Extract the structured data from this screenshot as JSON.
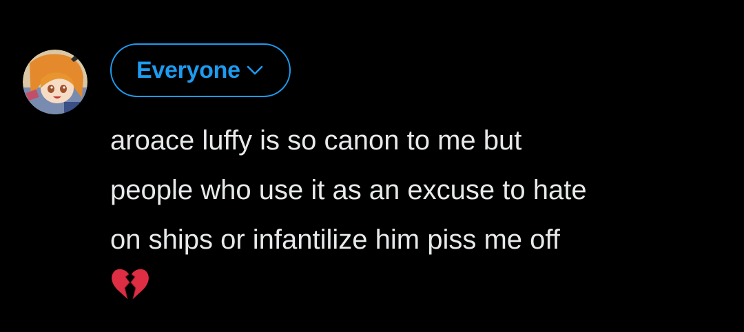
{
  "composer": {
    "avatar": {
      "icon": "profile-avatar-anime-orange-hair"
    },
    "audience": {
      "label": "Everyone",
      "icon": "chevron-down-icon",
      "color": "#1d9bf0"
    },
    "post": {
      "lines": [
        "aroace luffy is so canon to me but",
        "people who use it as an excuse to hate",
        "on ships or infantilize him piss me off"
      ],
      "emoji": "💔",
      "emoji_icon": "broken-heart-icon",
      "text_color": "#e7e9ea"
    }
  }
}
